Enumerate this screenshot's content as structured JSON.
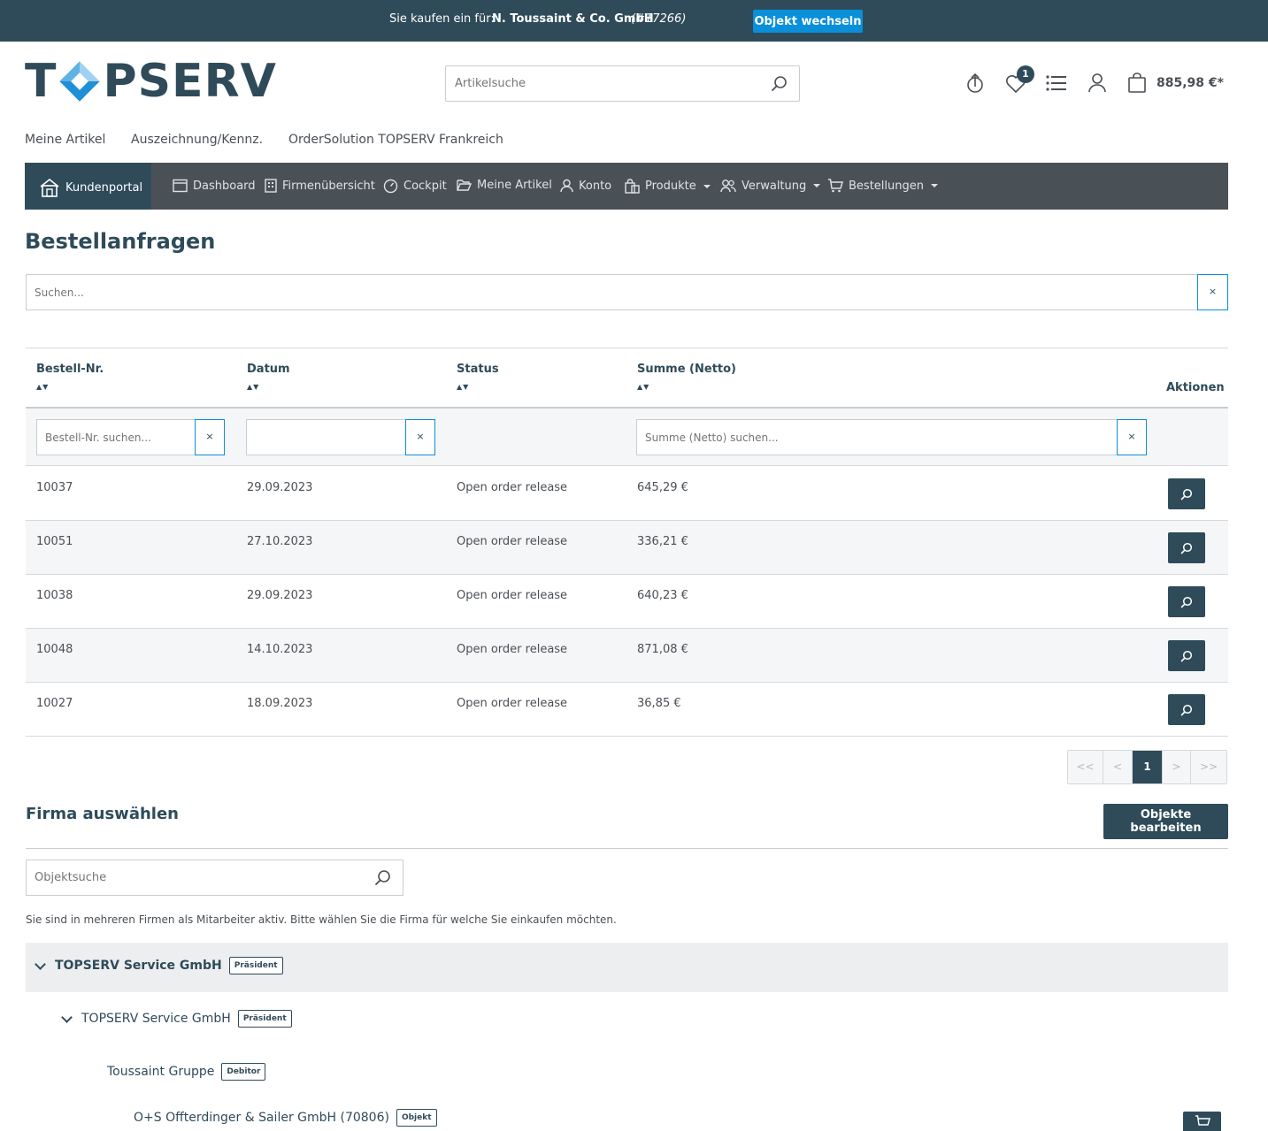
{
  "topbar": {
    "label": "Sie kaufen ein für:",
    "company": "N. Toussaint & Co. GmbH",
    "company_id": "(#17266)",
    "switch_button": "Objekt wechseln",
    "bg_color": "#2f4b5a",
    "button_color": "#0a8fd9"
  },
  "header": {
    "logo_text_left": "T",
    "logo_text_right": "PSERV",
    "search_placeholder": "Artikelsuche",
    "wishlist_count": "1",
    "cart_total": "885,98 €*"
  },
  "subnav": {
    "items": [
      "Meine Artikel",
      "Auszeichnung/Kennz.",
      "OrderSolution TOPSERV Frankreich"
    ]
  },
  "mainnav": {
    "active": "Kundenportal",
    "items": [
      "Dashboard",
      "Firmenübersicht",
      "Cockpit",
      "Meine Artikel",
      "Konto",
      "Produkte",
      "Verwaltung",
      "Bestellungen"
    ]
  },
  "page": {
    "title": "Bestellanfragen",
    "search_placeholder": "Suchen...",
    "clear": "×"
  },
  "table": {
    "columns": [
      "Bestell-Nr.",
      "Datum",
      "Status",
      "Summe (Netto)",
      "Aktionen"
    ],
    "sort_glyph": "▲▼",
    "filters": {
      "order_placeholder": "Bestell-Nr. suchen...",
      "date_placeholder": "",
      "sum_placeholder": "Summe (Netto) suchen..."
    },
    "rows": [
      {
        "order": "10037",
        "date": "29.09.2023",
        "status": "Open order release",
        "sum": "645,29 €"
      },
      {
        "order": "10051",
        "date": "27.10.2023",
        "status": "Open order release",
        "sum": "336,21 €"
      },
      {
        "order": "10038",
        "date": "29.09.2023",
        "status": "Open order release",
        "sum": "640,23 €"
      },
      {
        "order": "10048",
        "date": "14.10.2023",
        "status": "Open order release",
        "sum": "871,08 €"
      },
      {
        "order": "10027",
        "date": "18.09.2023",
        "status": "Open order release",
        "sum": "36,85 €"
      }
    ]
  },
  "pagination": {
    "first": "<<",
    "prev": "<",
    "current": "1",
    "next": ">",
    "last": ">>"
  },
  "company_select": {
    "title": "Firma auswählen",
    "edit_button": "Objekte bearbeiten",
    "search_placeholder": "Objektsuche",
    "hint": "Sie sind in mehreren Firmen als Mitarbeiter aktiv. Bitte wählen Sie die Firma für welche Sie einkaufen möchten.",
    "tree": [
      {
        "name": "TOPSERV Service GmbH",
        "tag": "Präsident"
      },
      {
        "name": "TOPSERV Service GmbH",
        "tag": "Präsident"
      },
      {
        "name": "Toussaint Gruppe",
        "tag": "Debitor"
      },
      {
        "name": "O+S Offterdinger & Sailer GmbH (70806)",
        "tag": "Objekt"
      }
    ]
  }
}
